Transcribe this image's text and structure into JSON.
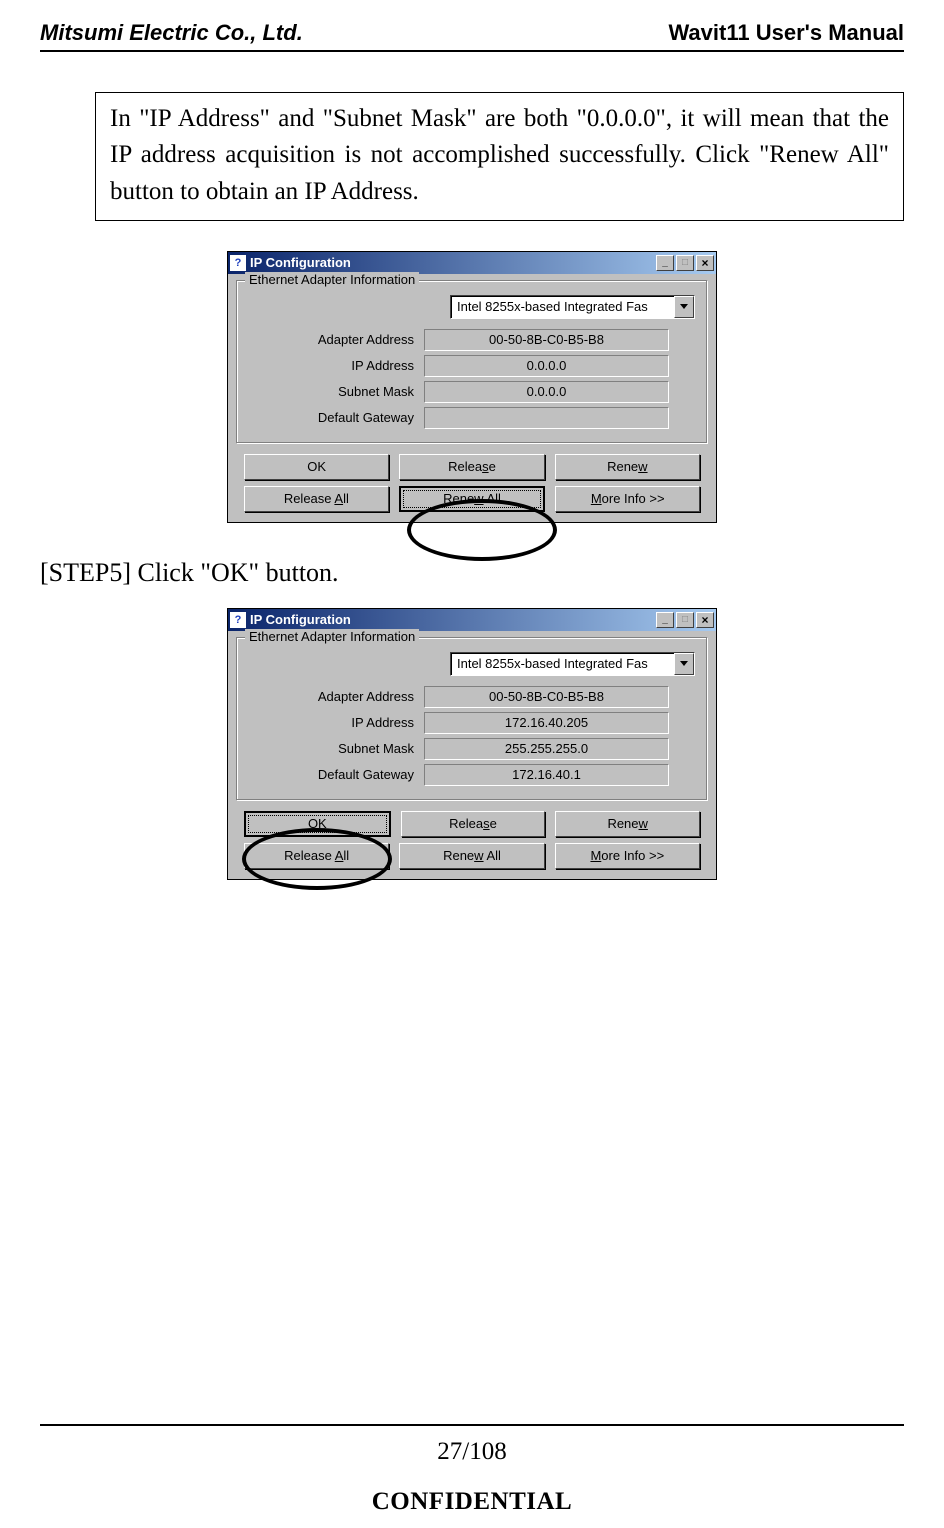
{
  "header": {
    "company": "Mitsumi Electric Co., Ltd.",
    "manual": "Wavit11 User's Manual"
  },
  "warning": {
    "text": "In \"IP Address\" and \"Subnet Mask\" are both \"0.0.0.0\", it will mean that the IP address acquisition is not accomplished successfully. Click \"Renew All\" button to obtain an IP Address."
  },
  "dialog_common": {
    "title": "IP Configuration",
    "group": "Ethernet  Adapter Information",
    "adapter_option": "Intel 8255x-based Integrated Fas",
    "labels": {
      "adapter_address": "Adapter Address",
      "ip_address": "IP Address",
      "subnet_mask": "Subnet Mask",
      "default_gateway": "Default Gateway"
    },
    "buttons": {
      "ok": "OK",
      "release": "Release",
      "renew": "Renew",
      "release_all": "Release All",
      "renew_all": "Renew All",
      "more_info": "More Info >>"
    }
  },
  "dialog1": {
    "adapter_address": "00-50-8B-C0-B5-B8",
    "ip_address": "0.0.0.0",
    "subnet_mask": "0.0.0.0",
    "default_gateway": ""
  },
  "step5_text": "[STEP5] Click \"OK\" button.",
  "dialog2": {
    "adapter_address": "00-50-8B-C0-B5-B8",
    "ip_address": "172.16.40.205",
    "subnet_mask": "255.255.255.0",
    "default_gateway": "172.16.40.1"
  },
  "footer": {
    "page": "27/108",
    "confidential": "CONFIDENTIAL"
  }
}
